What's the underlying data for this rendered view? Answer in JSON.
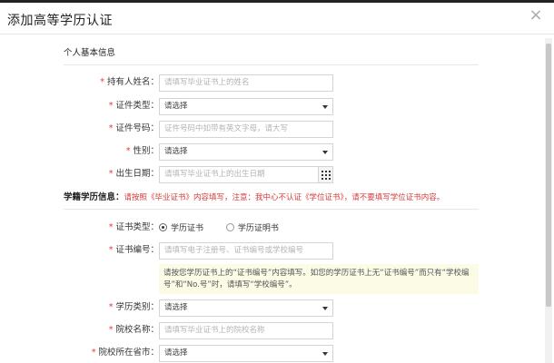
{
  "dialog": {
    "title": "添加高等学历认证",
    "close_symbol": "×"
  },
  "personal": {
    "section_title": "个人基本信息",
    "required_mark": "*",
    "fields": {
      "holder_name": {
        "label": "持有人姓名：",
        "placeholder": "请填写毕业证书上的姓名"
      },
      "id_type": {
        "label": "证件类型：",
        "value": "请选择"
      },
      "id_number": {
        "label": "证件号码：",
        "placeholder": "证件号码中如带有英文字母，请大写"
      },
      "gender": {
        "label": "性别：",
        "value": "请选择"
      },
      "birth_date": {
        "label": "出生日期：",
        "placeholder": "请填写毕业证书上的出生日期"
      }
    }
  },
  "education": {
    "section_title": "学籍学历信息：",
    "notice": "请按照《毕业证书》内容填写，注意：我中心不认证《学位证书》，请不要填写学位证书内容。",
    "fields": {
      "cert_type": {
        "label": "证书类型：",
        "options": [
          "学历证书",
          "学历证明书"
        ],
        "selected": "学历证书"
      },
      "cert_number": {
        "label": "证书编号：",
        "placeholder": "请填写电子注册号、证书编号或学校编号"
      },
      "cert_hint": "请按您学历证书上的“证书编号”内容填写。如您的学历证书上无“证书编号”而只有“学校编号”和“No.号”时，请填写“学校编号”。",
      "edu_level": {
        "label": "学历类别：",
        "value": "请选择"
      },
      "school_name": {
        "label": "院校名称：",
        "placeholder": "请填写毕业证书上的院校名称"
      },
      "school_city": {
        "label": "院校所在省市：",
        "value": "请选择"
      }
    }
  }
}
